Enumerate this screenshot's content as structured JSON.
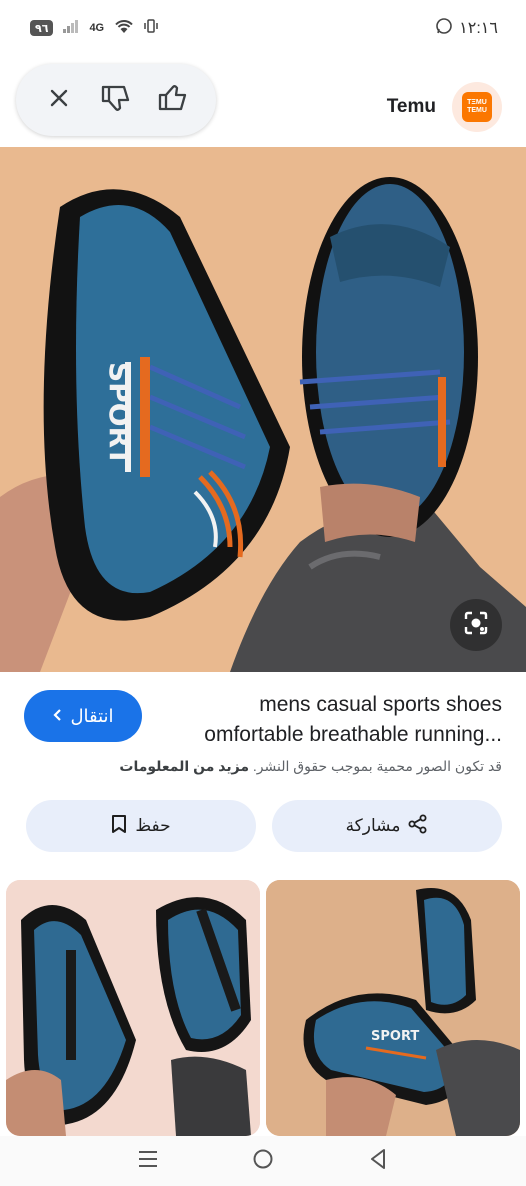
{
  "status_bar": {
    "battery": "٩٦",
    "network": "4G",
    "time": "١٢:١٦"
  },
  "header": {
    "source_name": "Temu",
    "logo_text_top": "ТΞMU",
    "logo_text_bottom": "TEMU"
  },
  "result": {
    "title_line1": "mens casual sports shoes",
    "title_line2": "omfortable breathable running...",
    "visit_label": "انتقال",
    "copyright_text": "قد تكون الصور محمية بموجب حقوق النشر.",
    "more_info": "مزيد من المعلومات"
  },
  "actions": {
    "share_label": "مشاركة",
    "save_label": "حفظ"
  },
  "colors": {
    "accent": "#1a73e8",
    "pill_bg": "#e8eefa",
    "temu_orange": "#fb7701"
  },
  "icons": {
    "close": "close-icon",
    "dislike": "thumbs-down-icon",
    "like": "thumbs-up-icon",
    "lens": "lens-icon",
    "share": "share-icon",
    "save": "bookmark-icon"
  }
}
